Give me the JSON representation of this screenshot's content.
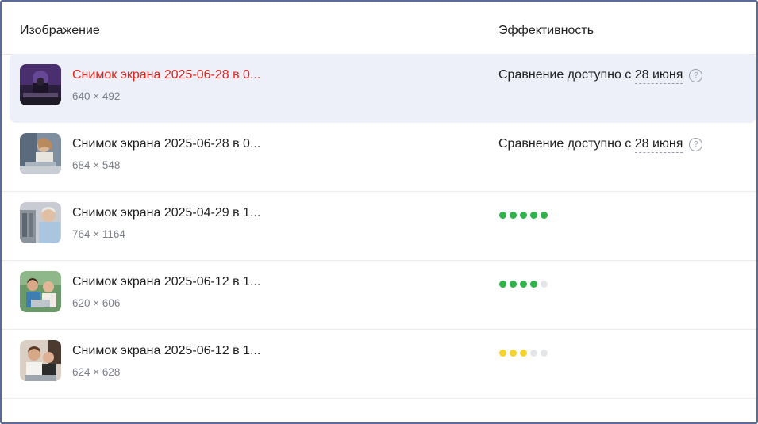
{
  "header": {
    "image_col": "Изображение",
    "efficiency_col": "Эффективность"
  },
  "rows": [
    {
      "name": "Снимок экрана 2025-06-28 в 0...",
      "dims": "640 × 492",
      "efficiency_prefix": "Сравнение доступно с ",
      "efficiency_date": "28 июня",
      "help": "?",
      "selected": true,
      "thumb_icon": "dark-desk-photo"
    },
    {
      "name": "Снимок экрана 2025-06-28 в 0...",
      "dims": "684 × 548",
      "efficiency_prefix": "Сравнение доступно с ",
      "efficiency_date": "28 июня",
      "help": "?",
      "selected": false,
      "thumb_icon": "woman-laptop-photo"
    },
    {
      "name": "Снимок экрана 2025-04-29 в 1...",
      "dims": "764 × 1164",
      "rating": 5,
      "rating_max": 5,
      "rating_color": "#2fb34a",
      "selected": false,
      "thumb_icon": "man-office-photo"
    },
    {
      "name": "Снимок экрана 2025-06-12 в 1...",
      "dims": "620 × 606",
      "rating": 4,
      "rating_max": 5,
      "rating_color": "#2fb34a",
      "selected": false,
      "thumb_icon": "people-laptop-photo"
    },
    {
      "name": "Снимок экрана 2025-06-12 в 1...",
      "dims": "624 × 628",
      "rating": 3,
      "rating_max": 5,
      "rating_color": "#f5d32f",
      "selected": false,
      "thumb_icon": "couple-laptop-photo"
    }
  ]
}
